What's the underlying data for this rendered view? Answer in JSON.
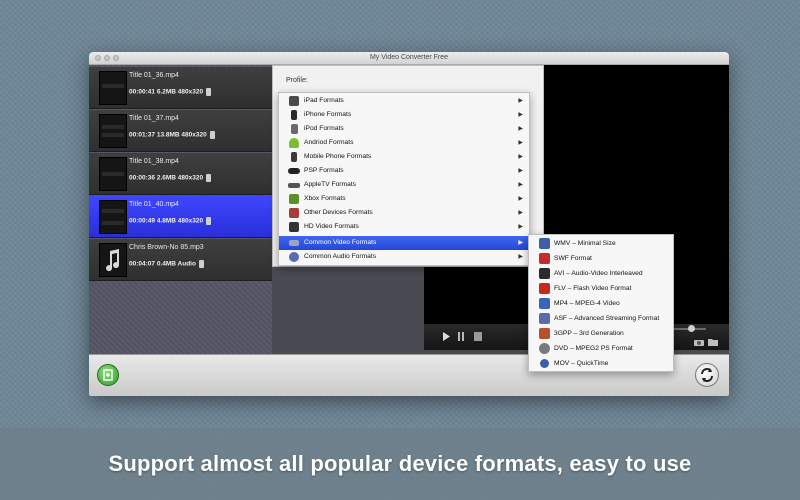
{
  "window": {
    "title": "My Video Converter Free"
  },
  "files": [
    {
      "name": "Title 01_36.mp4",
      "meta": "00:00:41 6.2MB 480x320"
    },
    {
      "name": "Title 01_37.mp4",
      "meta": "00:01:37 13.8MB 480x320"
    },
    {
      "name": "Title 01_38.mp4",
      "meta": "00:00:36 2.6MB 480x320"
    },
    {
      "name": "Title 01_40.mp4",
      "meta": "00:00:49 4.8MB 480x320",
      "selected": true
    },
    {
      "name": "Chris Brown-No 85.mp3",
      "meta": "00:04:07 0.4MB Audio"
    }
  ],
  "profile": {
    "label": "Profile:"
  },
  "format_menu": [
    {
      "label": "iPad Formats",
      "icon": "ipad-icon",
      "color": "#4a4a4a"
    },
    {
      "label": "iPhone Formats",
      "icon": "iphone-icon",
      "color": "#2a2a2a"
    },
    {
      "label": "iPod Formats",
      "icon": "ipod-icon",
      "color": "#6a6a6a"
    },
    {
      "label": "Andriod Formats",
      "icon": "android-icon",
      "color": "#7cbf2e"
    },
    {
      "label": "Mobile Phone Formats",
      "icon": "mobile-phone-icon",
      "color": "#3a3a3a"
    },
    {
      "label": "PSP Formats",
      "icon": "psp-icon",
      "color": "#222222"
    },
    {
      "label": "AppleTV Formats",
      "icon": "appletv-icon",
      "color": "#555555"
    },
    {
      "label": "Xbox Formats",
      "icon": "xbox-icon",
      "color": "#5a8f2a"
    },
    {
      "label": "Other Devices Formats",
      "icon": "other-devices-icon",
      "color": "#a83a3a"
    },
    {
      "label": "HD Video Formats",
      "icon": "hd-video-icon",
      "color": "#333333"
    },
    {
      "label": "Common Video Formats",
      "icon": "common-video-icon",
      "color": "#9aa4c9",
      "active": true
    },
    {
      "label": "Common Audio Formats",
      "icon": "common-audio-icon",
      "color": "#5a6bb0"
    }
  ],
  "video_submenu": [
    {
      "label": "WMV – Minimal Size",
      "icon": "wmv-icon",
      "color": "#3c5fa8"
    },
    {
      "label": "SWF Format",
      "icon": "swf-icon",
      "color": "#c92a2a"
    },
    {
      "label": "AVI – Audio-Video Interleaved",
      "icon": "avi-icon",
      "color": "#2b2b2b"
    },
    {
      "label": "FLV – Flash Video Format",
      "icon": "flv-icon",
      "color": "#c42b1c"
    },
    {
      "label": "MP4 – MPEG-4 Video",
      "icon": "mp4-icon",
      "color": "#3a64b8"
    },
    {
      "label": "ASF – Advanced Streaming Format",
      "icon": "asf-icon",
      "color": "#5a6bb0"
    },
    {
      "label": "3GPP – 3rd Generation",
      "icon": "3gpp-icon",
      "color": "#b5502a"
    },
    {
      "label": "DVD – MPEG2 PS Format",
      "icon": "dvd-icon",
      "color": "#7a7a7a"
    },
    {
      "label": "MOV – QuickTime",
      "icon": "mov-icon",
      "color": "#3c5fa8"
    }
  ],
  "promo": {
    "text": "Support almost all popular device formats, easy to use"
  }
}
